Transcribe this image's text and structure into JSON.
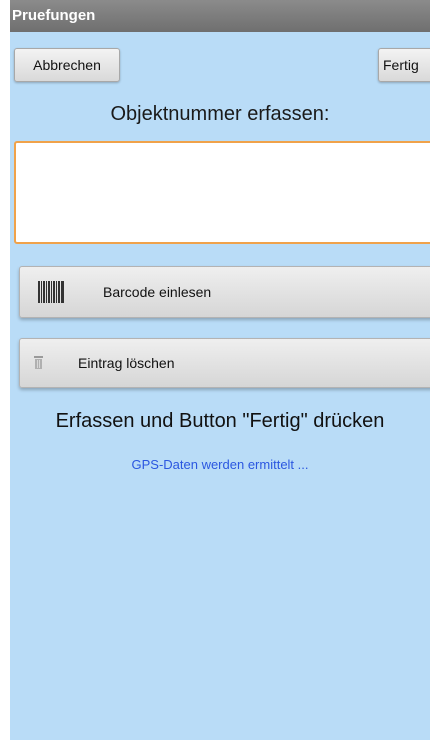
{
  "window": {
    "title": "Pruefungen"
  },
  "toolbar": {
    "cancel_label": "Abbrechen",
    "done_label": "Fertig"
  },
  "form": {
    "heading": "Objektnummer erfassen:",
    "object_number_value": "",
    "object_number_placeholder": ""
  },
  "actions": {
    "barcode_label": "Barcode einlesen",
    "barcode_icon": "barcode-icon",
    "delete_label": "Eintrag löschen",
    "delete_icon": "trash-icon"
  },
  "instruction": "Erfassen und Button \"Fertig\" drücken",
  "gps_status": "GPS-Daten werden ermittelt ...",
  "colors": {
    "background": "#b9dcf7",
    "titlebar": "#7a7a7a",
    "field_border": "#f0a24a",
    "gps_text": "#2b57e0"
  }
}
